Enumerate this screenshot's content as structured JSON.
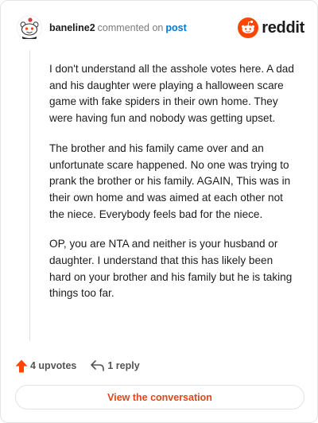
{
  "header": {
    "username": "baneline2",
    "byline_text": "commented on",
    "post_link": "post",
    "brand": "reddit"
  },
  "comment": {
    "paragraphs": [
      "I don't understand all the asshole votes here. A dad and his daughter were playing a halloween scare game with fake spiders in their own home. They were having fun and nobody was getting upset.",
      "The brother and his family came over and an unfortunate scare happened. No one was trying to prank the brother or his family. AGAIN, This was in their own home and was aimed at each other not the niece. Everybody feels bad for the niece.",
      "OP, you are NTA and neither is your husband or daughter. I understand that this has likely been hard on your brother and his family but he is taking things too far."
    ]
  },
  "actions": {
    "upvotes": "4 upvotes",
    "replies": "1 reply"
  },
  "cta": {
    "label": "View the conversation"
  },
  "colors": {
    "brand_orange": "#ff4500",
    "link_blue": "#0079d3",
    "cta_text": "#e0451b"
  },
  "icons": {
    "avatar": "snoo-avatar",
    "brand": "reddit-logo-icon",
    "upvote": "upvote-arrow-icon",
    "reply": "reply-arrow-icon"
  }
}
